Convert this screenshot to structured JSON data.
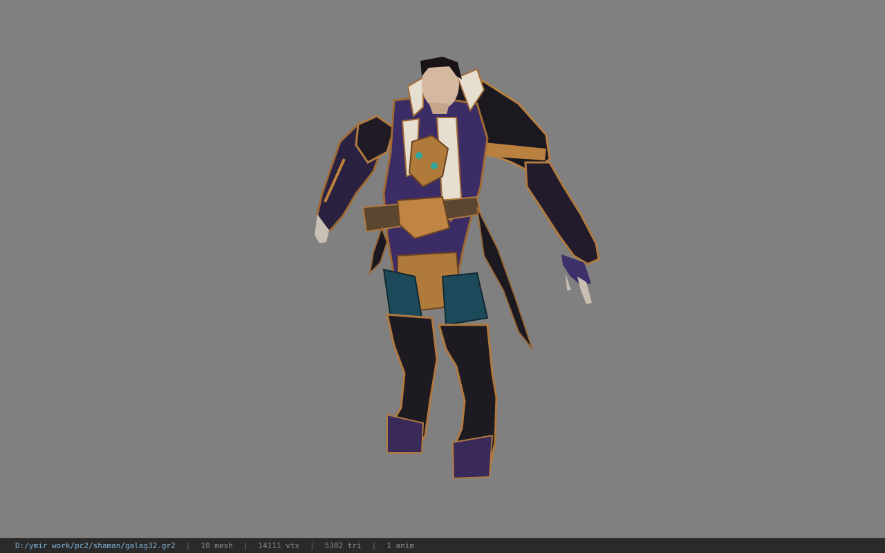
{
  "viewport": {
    "background_color": "#808080",
    "model_description_icon": "armored-character-model-icon"
  },
  "statusbar": {
    "file_path": "D:/ymir work/pc2/shaman/galag32.gr2",
    "separator": "|",
    "mesh_count": "10 mesh",
    "vertex_count": "14111 vtx",
    "triangle_count": "5302 tri",
    "anim_count": "1 anim",
    "path_color": "#7fb3d9"
  }
}
